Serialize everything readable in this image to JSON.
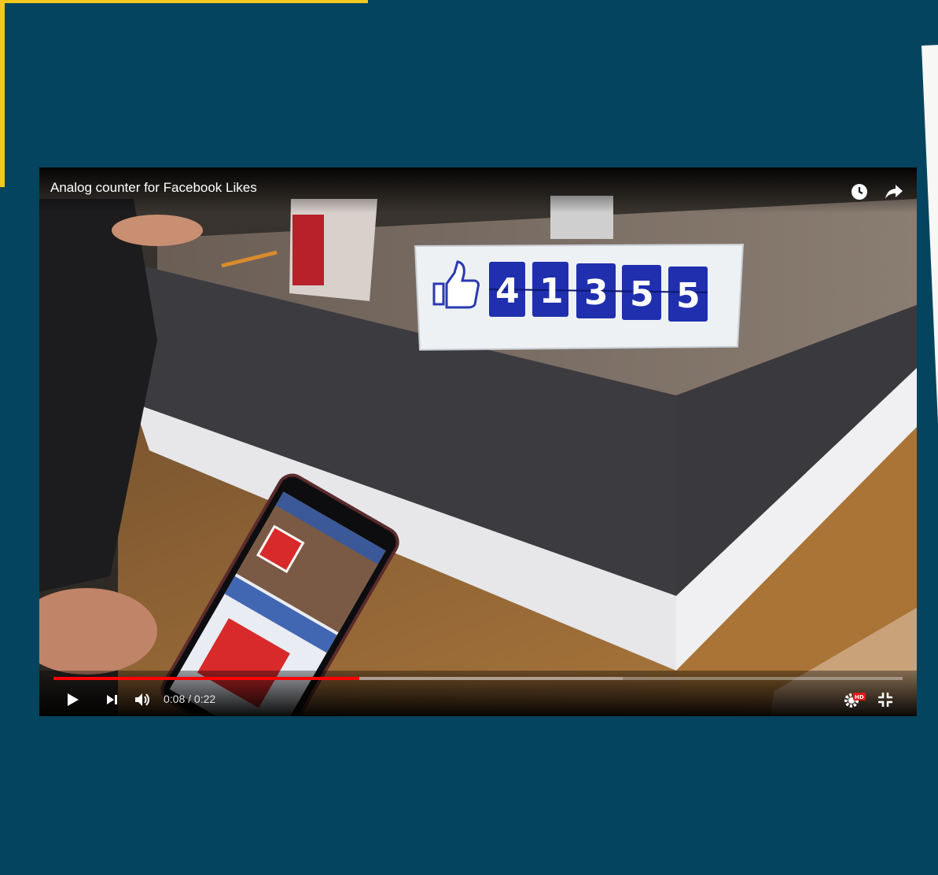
{
  "video": {
    "title": "Analog counter for Facebook Likes",
    "time_current": "0:08",
    "time_separator": " / ",
    "time_total": "0:22",
    "progress_fraction": 0.36,
    "buffered_fraction": 0.67,
    "hd_badge": "HD"
  },
  "counter": {
    "digits": [
      "4",
      "1",
      "3",
      "5",
      "5"
    ]
  },
  "icons": {
    "watch_later": "clock-icon",
    "share": "share-arrow-icon",
    "play": "play-icon",
    "next": "next-icon",
    "volume": "volume-icon",
    "settings": "gear-icon",
    "exit_fullscreen": "exit-fullscreen-icon"
  },
  "colors": {
    "background": "#04445f",
    "accent_frame": "#f4c81d",
    "progress": "#ff0000",
    "counter_tile": "#1f2fae"
  }
}
